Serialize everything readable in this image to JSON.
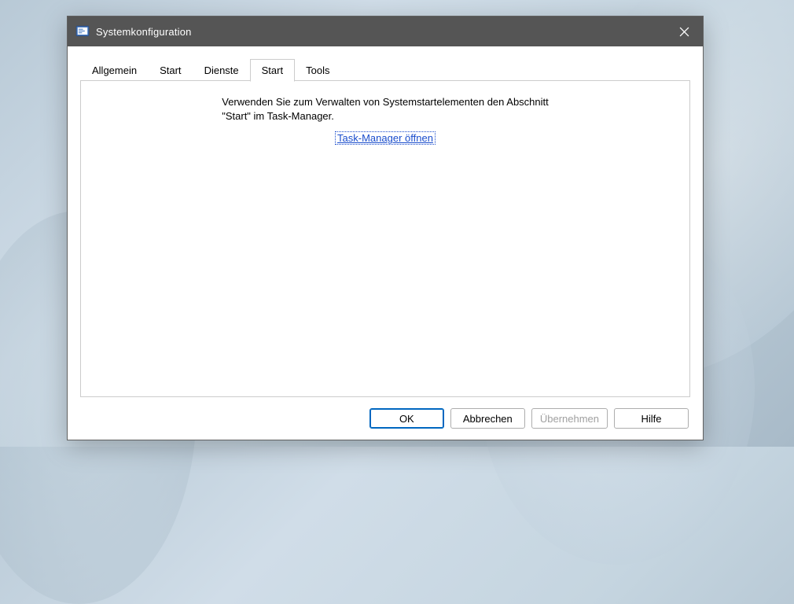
{
  "titlebar": {
    "title": "Systemkonfiguration"
  },
  "tabs": [
    {
      "label": "Allgemein",
      "active": false
    },
    {
      "label": "Start",
      "active": false
    },
    {
      "label": "Dienste",
      "active": false
    },
    {
      "label": "Start",
      "active": true
    },
    {
      "label": "Tools",
      "active": false
    }
  ],
  "content": {
    "message_line1": "Verwenden Sie zum Verwalten von Systemstartelementen den Abschnitt",
    "message_line2": "\"Start\" im Task-Manager.",
    "link_text": "Task-Manager öffnen"
  },
  "buttons": {
    "ok": "OK",
    "cancel": "Abbrechen",
    "apply": "Übernehmen",
    "help": "Hilfe"
  }
}
